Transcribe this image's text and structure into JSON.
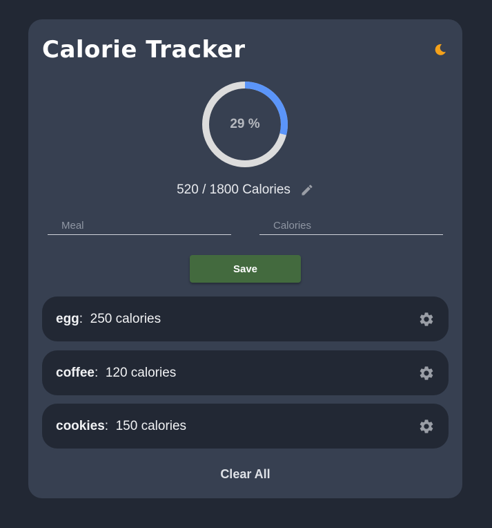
{
  "app": {
    "title": "Calorie Tracker",
    "theme_icon": "moon-icon"
  },
  "progress": {
    "percent": 29,
    "label": "29 %",
    "consumed": 520,
    "goal": 1800,
    "summary": "520 / 1800 Calories",
    "track_color": "#dcdcdc",
    "fill_color": "#5b95f9"
  },
  "form": {
    "meal_placeholder": "Meal",
    "meal_value": "",
    "calories_placeholder": "Calories",
    "calories_value": "",
    "save_label": "Save"
  },
  "items": [
    {
      "name": "egg",
      "separator": ":",
      "calories_text": "250 calories"
    },
    {
      "name": "coffee",
      "separator": ":",
      "calories_text": "120 calories"
    },
    {
      "name": "cookies",
      "separator": ":",
      "calories_text": "150 calories"
    }
  ],
  "clear_all_label": "Clear All",
  "colors": {
    "background": "#222834",
    "card": "#374051",
    "save_button": "#436a3e",
    "moon": "#f4a11a",
    "icon_gray": "#9a9ea6"
  }
}
